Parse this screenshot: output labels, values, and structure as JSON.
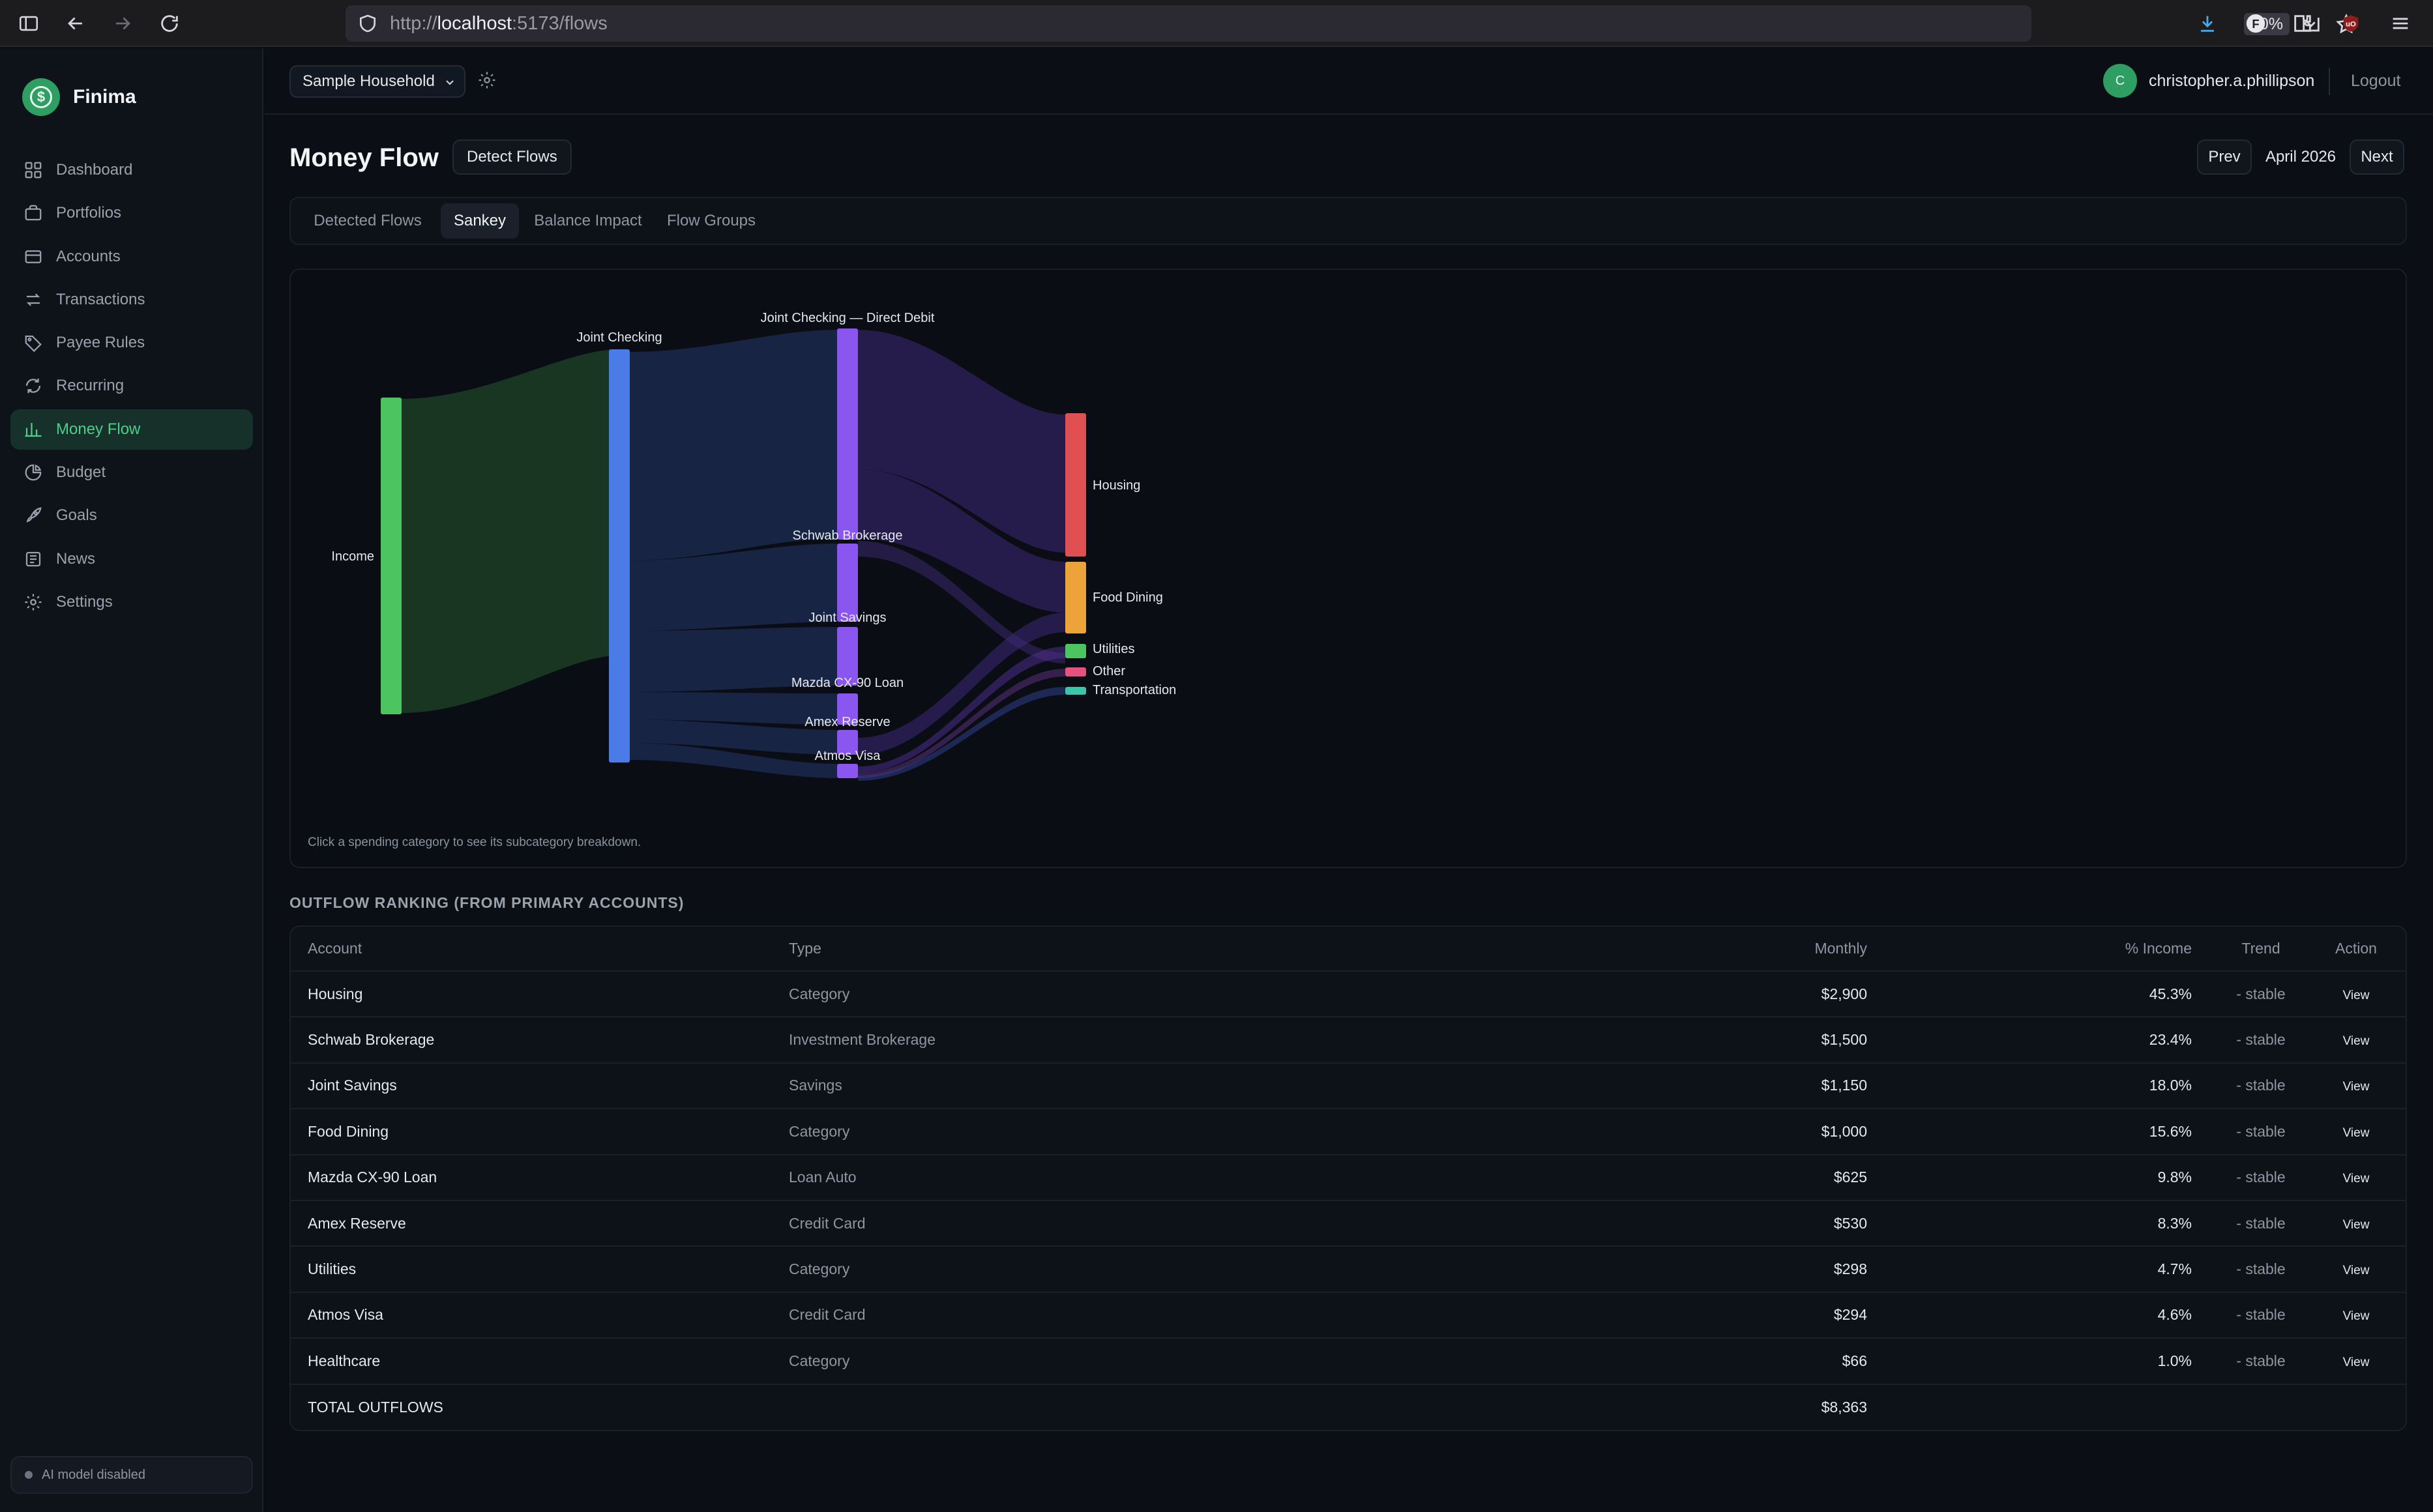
{
  "browser": {
    "url_prefix": "http://",
    "url_host": "localhost",
    "url_path": ":5173/flows",
    "zoom": "80%"
  },
  "sidebar": {
    "brand": "Finima",
    "items": [
      {
        "label": "Dashboard",
        "icon": "grid-icon"
      },
      {
        "label": "Portfolios",
        "icon": "briefcase-icon"
      },
      {
        "label": "Accounts",
        "icon": "wallet-icon"
      },
      {
        "label": "Transactions",
        "icon": "arrows-icon"
      },
      {
        "label": "Payee Rules",
        "icon": "tag-icon"
      },
      {
        "label": "Recurring",
        "icon": "refresh-icon"
      },
      {
        "label": "Money Flow",
        "icon": "bar-chart-icon",
        "active": true
      },
      {
        "label": "Budget",
        "icon": "pie-icon"
      },
      {
        "label": "Goals",
        "icon": "rocket-icon"
      },
      {
        "label": "News",
        "icon": "newspaper-icon"
      },
      {
        "label": "Settings",
        "icon": "gear-icon"
      }
    ],
    "ai_status": "AI model disabled"
  },
  "header": {
    "household": "Sample Household",
    "user_initial": "C",
    "user_name": "christopher.a.phillipson",
    "logout": "Logout"
  },
  "page": {
    "title": "Money Flow",
    "detect_button": "Detect Flows",
    "prev": "Prev",
    "month": "April 2026",
    "next": "Next"
  },
  "tabs": [
    "Detected Flows",
    "Sankey",
    "Balance Impact",
    "Flow Groups"
  ],
  "active_tab": "Sankey",
  "sankey": {
    "hint": "Click a spending category to see its subcategory breakdown.",
    "nodes": [
      {
        "id": "income",
        "label": "Income",
        "color": "#4cc45f"
      },
      {
        "id": "joint-checking",
        "label": "Joint Checking",
        "color": "#4b7be6"
      },
      {
        "id": "direct-debit",
        "label": "Joint Checking — Direct Debit",
        "color": "#8b55f0"
      },
      {
        "id": "schwab",
        "label": "Schwab Brokerage",
        "color": "#8b55f0"
      },
      {
        "id": "joint-savings",
        "label": "Joint Savings",
        "color": "#8b55f0"
      },
      {
        "id": "mazda",
        "label": "Mazda CX-90 Loan",
        "color": "#8b55f0"
      },
      {
        "id": "amex",
        "label": "Amex Reserve",
        "color": "#8b55f0"
      },
      {
        "id": "atmos",
        "label": "Atmos Visa",
        "color": "#8b55f0"
      },
      {
        "id": "housing",
        "label": "Housing",
        "color": "#e04f51"
      },
      {
        "id": "food",
        "label": "Food Dining",
        "color": "#eba33a"
      },
      {
        "id": "utilities",
        "label": "Utilities",
        "color": "#4cc45f"
      },
      {
        "id": "other",
        "label": "Other",
        "color": "#e8507d"
      },
      {
        "id": "transport",
        "label": "Transportation",
        "color": "#3cc5a8"
      }
    ]
  },
  "ranking": {
    "heading": "OUTFLOW RANKING (FROM PRIMARY ACCOUNTS)",
    "columns": [
      "Account",
      "Type",
      "Monthly",
      "% Income",
      "Trend",
      "Action"
    ],
    "rows": [
      {
        "account": "Housing",
        "type": "Category",
        "monthly": "$2,900",
        "pct": "45.3%",
        "trend": "- stable",
        "action": "View"
      },
      {
        "account": "Schwab Brokerage",
        "type": "Investment Brokerage",
        "monthly": "$1,500",
        "pct": "23.4%",
        "trend": "- stable",
        "action": "View"
      },
      {
        "account": "Joint Savings",
        "type": "Savings",
        "monthly": "$1,150",
        "pct": "18.0%",
        "trend": "- stable",
        "action": "View"
      },
      {
        "account": "Food Dining",
        "type": "Category",
        "monthly": "$1,000",
        "pct": "15.6%",
        "trend": "- stable",
        "action": "View"
      },
      {
        "account": "Mazda CX-90 Loan",
        "type": "Loan Auto",
        "monthly": "$625",
        "pct": "9.8%",
        "trend": "- stable",
        "action": "View"
      },
      {
        "account": "Amex Reserve",
        "type": "Credit Card",
        "monthly": "$530",
        "pct": "8.3%",
        "trend": "- stable",
        "action": "View"
      },
      {
        "account": "Utilities",
        "type": "Category",
        "monthly": "$298",
        "pct": "4.7%",
        "trend": "- stable",
        "action": "View"
      },
      {
        "account": "Atmos Visa",
        "type": "Credit Card",
        "monthly": "$294",
        "pct": "4.6%",
        "trend": "- stable",
        "action": "View"
      },
      {
        "account": "Healthcare",
        "type": "Category",
        "monthly": "$66",
        "pct": "1.0%",
        "trend": "- stable",
        "action": "View"
      }
    ],
    "total_label": "TOTAL OUTFLOWS",
    "total_value": "$8,363"
  }
}
